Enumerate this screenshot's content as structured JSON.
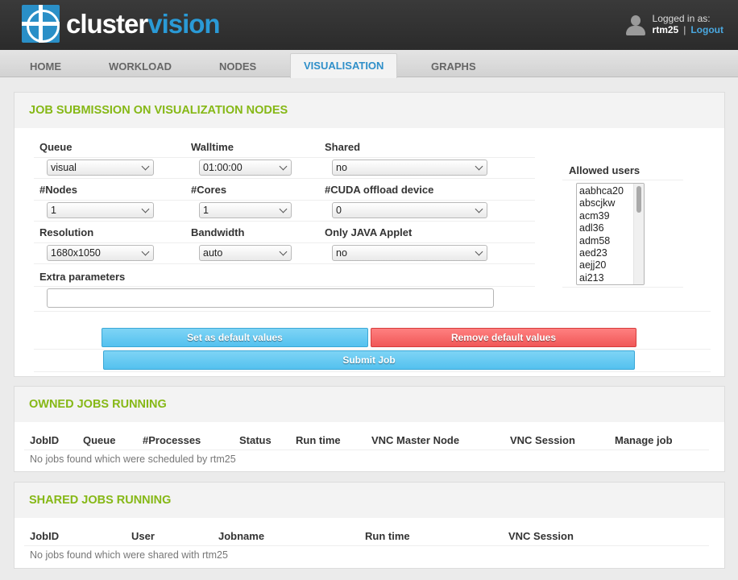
{
  "brand": {
    "name_part1": "cluster",
    "name_part2": "vision"
  },
  "user": {
    "logged_in_label": "Logged in as:",
    "username": "rtm25",
    "separator": "|",
    "logout": "Logout"
  },
  "tabs": [
    {
      "label": "HOME"
    },
    {
      "label": "WORKLOAD"
    },
    {
      "label": "NODES"
    },
    {
      "label": "VISUALISATION",
      "active": true
    },
    {
      "label": "GRAPHS"
    }
  ],
  "submission": {
    "title": "JOB SUBMISSION ON VISUALIZATION NODES",
    "fields": {
      "queue": {
        "label": "Queue",
        "value": "visual"
      },
      "walltime": {
        "label": "Walltime",
        "value": "01:00:00"
      },
      "shared": {
        "label": "Shared",
        "value": "no"
      },
      "nodes": {
        "label": "#Nodes",
        "value": "1"
      },
      "cores": {
        "label": "#Cores",
        "value": "1"
      },
      "cuda": {
        "label": "#CUDA offload device",
        "value": "0"
      },
      "resolution": {
        "label": "Resolution",
        "value": "1680x1050"
      },
      "bandwidth": {
        "label": "Bandwidth",
        "value": "auto"
      },
      "java": {
        "label": "Only JAVA Applet",
        "value": "no"
      },
      "extra": {
        "label": "Extra parameters",
        "value": ""
      }
    },
    "allowed_users": {
      "label": "Allowed users",
      "items": [
        "aabhca20",
        "abscjkw",
        "acm39",
        "adl36",
        "adm58",
        "aed23",
        "aejj20",
        "ai213"
      ]
    },
    "buttons": {
      "set_default": "Set as default values",
      "remove_default": "Remove default values",
      "submit": "Submit Job"
    }
  },
  "owned_jobs": {
    "title": "OWNED JOBS RUNNING",
    "columns": [
      "JobID",
      "Queue",
      "#Processes",
      "Status",
      "Run time",
      "VNC Master Node",
      "VNC Session",
      "Manage job"
    ],
    "empty_message": "No jobs found which were scheduled by rtm25"
  },
  "shared_jobs": {
    "title": "SHARED JOBS RUNNING",
    "columns": [
      "JobID",
      "User",
      "Jobname",
      "Run time",
      "VNC Session"
    ],
    "empty_message": "No jobs found which were shared with rtm25"
  },
  "colors": {
    "accent_green": "#86b816",
    "accent_blue": "#2f8fc9",
    "button_blue": "#54c1ef",
    "button_red": "#f05757"
  }
}
